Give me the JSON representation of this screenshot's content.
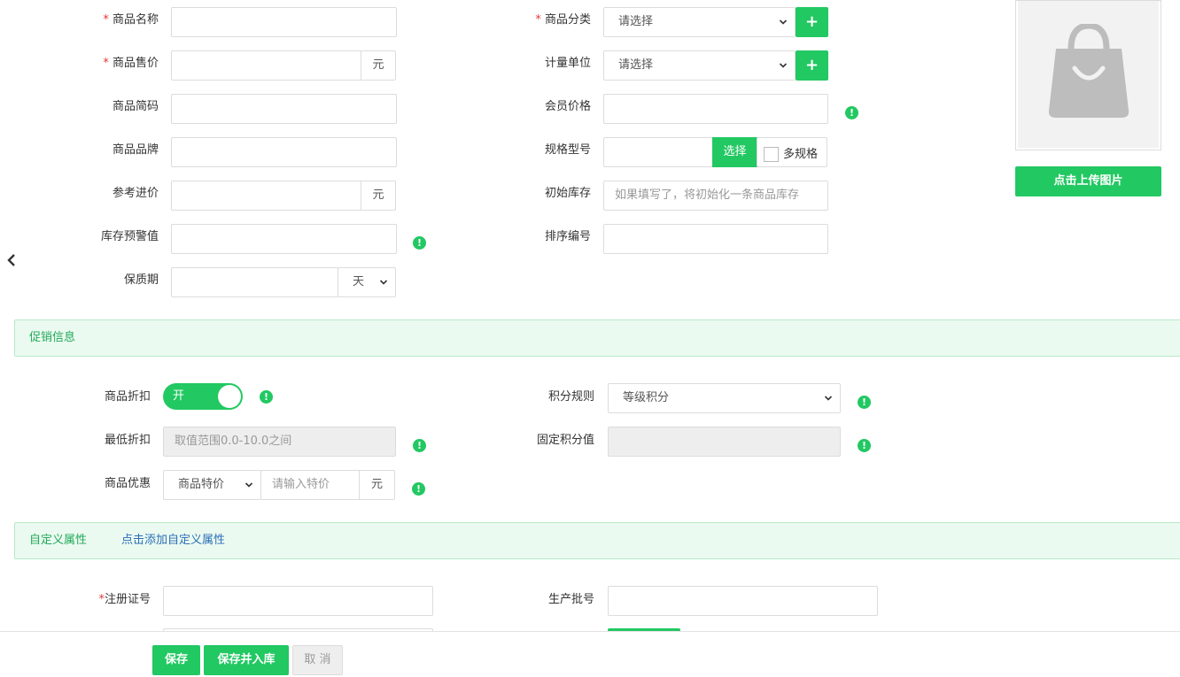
{
  "basic": {
    "name_label": "商品名称",
    "price_label": "商品售价",
    "price_unit": "元",
    "short_code_label": "商品简码",
    "brand_label": "商品品牌",
    "ref_cost_label": "参考进价",
    "ref_cost_unit": "元",
    "stock_warn_label": "库存预警值",
    "shelf_life_label": "保质期",
    "shelf_life_unit": "天",
    "category_label": "商品分类",
    "category_value": "请选择",
    "unit_label": "计量单位",
    "unit_value": "请选择",
    "member_price_label": "会员价格",
    "spec_label": "规格型号",
    "spec_select_button": "选择",
    "multi_spec_label": "多规格",
    "initial_stock_label": "初始库存",
    "initial_stock_placeholder": "如果填写了，将初始化一条商品库存",
    "sort_no_label": "排序编号",
    "upload_button": "点击上传图片",
    "required_mark": "*",
    "add_symbol": "+",
    "warn_symbol": "!"
  },
  "promotion": {
    "section_title": "促销信息",
    "discount_label": "商品折扣",
    "discount_toggle_text": "开",
    "min_discount_label": "最低折扣",
    "min_discount_placeholder": "取值范围0.0-10.0之间",
    "offer_label": "商品优惠",
    "offer_type_value": "商品特价",
    "special_price_placeholder": "请输入特价",
    "special_price_unit": "元",
    "points_rule_label": "积分规则",
    "points_rule_value": "等级积分",
    "fixed_points_label": "固定积分值"
  },
  "custom": {
    "section_title": "自定义属性",
    "add_link": "点击添加自定义属性",
    "reg_no_label": "注册证号",
    "batch_no_label": "生产批号"
  },
  "footer": {
    "save": "保存",
    "save_and_stock": "保存并入库",
    "cancel": "取 消"
  }
}
